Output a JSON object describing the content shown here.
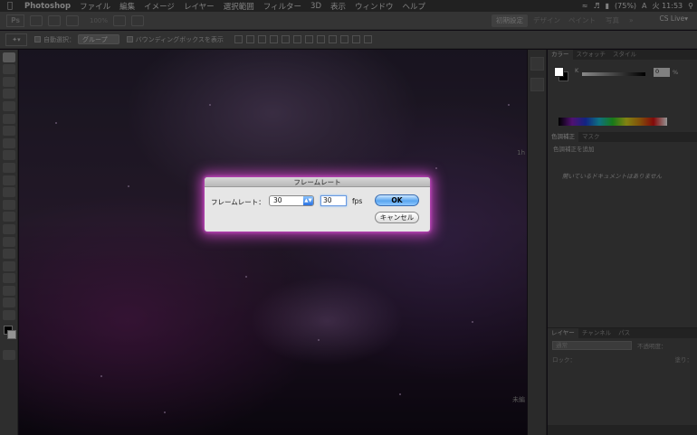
{
  "menubar": {
    "app_name": "Photoshop",
    "menus": [
      "ファイル",
      "編集",
      "イメージ",
      "レイヤー",
      "選択範囲",
      "フィルター",
      "3D",
      "表示",
      "ウィンドウ",
      "ヘルプ"
    ],
    "battery": "(75%)",
    "input_method": "A",
    "clock": "火 11:53"
  },
  "appbar": {
    "logo": "Ps",
    "zoom": "100%",
    "workspaces": [
      "初期設定",
      "デザイン",
      "ペイント",
      "写真"
    ],
    "more": "»",
    "cs_live": "CS Live▾"
  },
  "options_bar": {
    "auto_select_label": "自動選択：",
    "auto_select_value": "グループ",
    "bounding_box_label": "バウンディングボックスを表示"
  },
  "panels": {
    "color_tabs": [
      "カラー",
      "スウォッチ",
      "スタイル"
    ],
    "k_label": "K",
    "k_value": "0",
    "k_pct": "%",
    "adjust_tabs": [
      "色調補正",
      "マスク"
    ],
    "adjust_add": "色調補正を追加",
    "no_document": "開いているドキュメントはありません",
    "layer_tabs": [
      "レイヤー",
      "チャンネル",
      "パス"
    ],
    "blend_mode": "通常",
    "opacity_label": "不透明度：",
    "lock_label": "ロック：",
    "fill_label": "塗り："
  },
  "dialog": {
    "title": "フレームレート",
    "frame_rate_label": "フレームレート：",
    "popup_value": "30",
    "fps_value": "30",
    "fps_unit": "fps",
    "ok": "OK",
    "cancel": "キャンセル"
  },
  "corner": {
    "right_mid": "1h",
    "right_bottom": "未編"
  },
  "colors": {
    "dialog_glow": "#cd46c8",
    "ok_button": "#5aa5ef"
  }
}
